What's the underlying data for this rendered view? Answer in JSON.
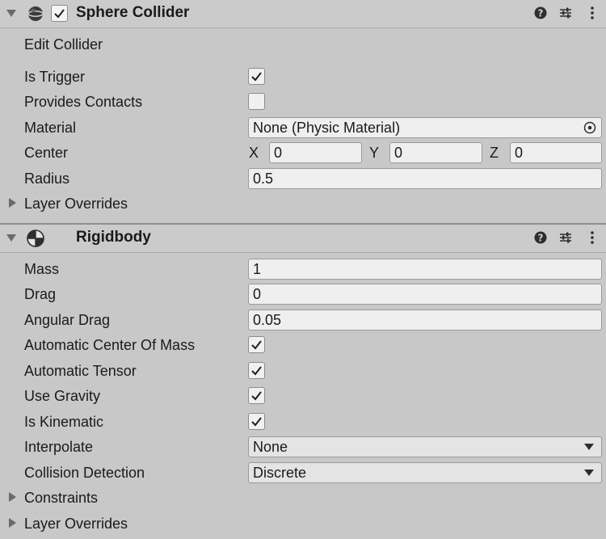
{
  "sphere_collider": {
    "title": "Sphere Collider",
    "enabled": true,
    "edit_collider_label": "Edit Collider",
    "is_trigger": {
      "label": "Is Trigger",
      "checked": true
    },
    "provides_contacts": {
      "label": "Provides Contacts",
      "checked": false
    },
    "material": {
      "label": "Material",
      "value": "None (Physic Material)"
    },
    "center": {
      "label": "Center",
      "x_label": "X",
      "x": "0",
      "y_label": "Y",
      "y": "0",
      "z_label": "Z",
      "z": "0"
    },
    "radius": {
      "label": "Radius",
      "value": "0.5"
    },
    "layer_overrides_label": "Layer Overrides"
  },
  "rigidbody": {
    "title": "Rigidbody",
    "mass": {
      "label": "Mass",
      "value": "1"
    },
    "drag": {
      "label": "Drag",
      "value": "0"
    },
    "angular_drag": {
      "label": "Angular Drag",
      "value": "0.05"
    },
    "automatic_center_of_mass": {
      "label": "Automatic Center Of Mass",
      "checked": true
    },
    "automatic_tensor": {
      "label": "Automatic Tensor",
      "checked": true
    },
    "use_gravity": {
      "label": "Use Gravity",
      "checked": true
    },
    "is_kinematic": {
      "label": "Is Kinematic",
      "checked": true
    },
    "interpolate": {
      "label": "Interpolate",
      "value": "None"
    },
    "collision_detection": {
      "label": "Collision Detection",
      "value": "Discrete"
    },
    "constraints_label": "Constraints",
    "layer_overrides_label": "Layer Overrides"
  },
  "icons": [
    "help-icon",
    "presets-icon",
    "more-menu-icon",
    "sphere-collider-icon",
    "rigidbody-icon",
    "object-picker-icon",
    "dropdown-arrow-icon",
    "foldout-arrow-icon",
    "checkmark-icon"
  ]
}
